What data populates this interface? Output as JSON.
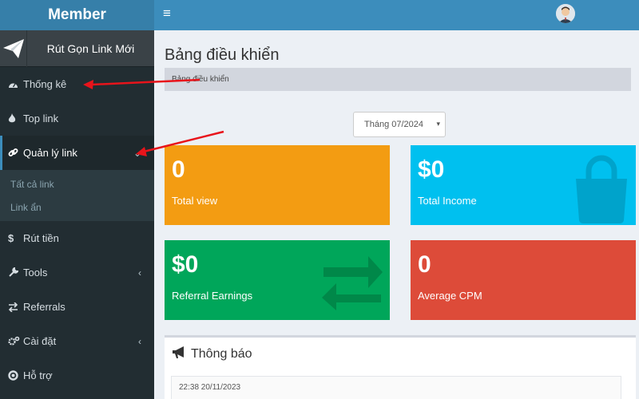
{
  "sidebar": {
    "brand": "Member",
    "shortlink_label": "Rút Gọn Link Mới",
    "items": [
      {
        "label": "Thống kê",
        "icon": "dashboard-icon"
      },
      {
        "label": "Top link",
        "icon": "fire-icon"
      },
      {
        "label": "Quản lý link",
        "icon": "link-icon"
      },
      {
        "label": "Rút tiền",
        "icon": "dollar-icon"
      },
      {
        "label": "Tools",
        "icon": "wrench-icon"
      },
      {
        "label": "Referrals",
        "icon": "exchange-icon"
      },
      {
        "label": "Cài đặt",
        "icon": "cogs-icon"
      },
      {
        "label": "Hỗ trợ",
        "icon": "support-icon"
      }
    ],
    "submenu": [
      "Tất cả link",
      "Link ẩn"
    ]
  },
  "topbar": {
    "menu_icon": "hamburger-icon",
    "avatar": "user-avatar"
  },
  "main": {
    "title": "Bảng điều khiển",
    "breadcrumb": "Bảng điều khiển",
    "month": "Tháng 07/2024",
    "stats": [
      {
        "value": "0",
        "label": "Total view",
        "color": "#f39c12"
      },
      {
        "value": "$0",
        "label": "Total Income",
        "color": "#00c0ef"
      },
      {
        "value": "$0",
        "label": "Referral Earnings",
        "color": "#00a65a"
      },
      {
        "value": "0",
        "label": "Average CPM",
        "color": "#dd4b39"
      }
    ],
    "notice": {
      "title": "Thông báo",
      "timestamp": "22:38 20/11/2023"
    }
  },
  "colors": {
    "annotation_arrow": "#e8141b",
    "sidebar": "#222d32",
    "topbar": "#3c8dbc"
  }
}
